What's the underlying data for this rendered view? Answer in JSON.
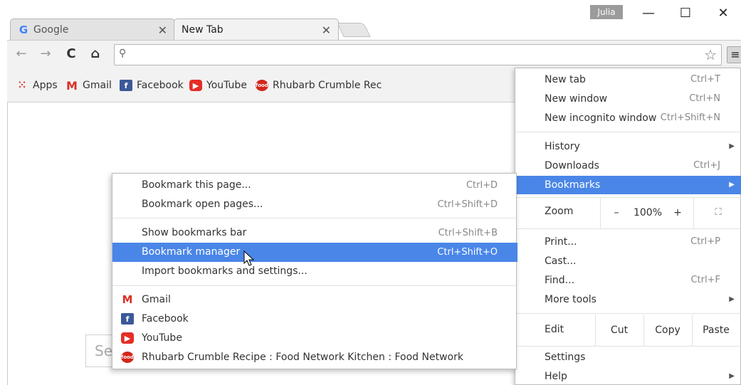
{
  "tabs": [
    {
      "label": "Google",
      "icon": "google-g-icon",
      "active": false
    },
    {
      "label": "New Tab",
      "icon": "",
      "active": true
    }
  ],
  "profile": "Julia",
  "window_controls": {
    "minimize": "—",
    "maximize": "☐",
    "close": "✕"
  },
  "bookmarks_bar": [
    {
      "label": "Apps",
      "icon": "apps-grid-icon"
    },
    {
      "label": "Gmail",
      "icon": "gmail-icon"
    },
    {
      "label": "Facebook",
      "icon": "facebook-icon"
    },
    {
      "label": "YouTube",
      "icon": "youtube-icon"
    },
    {
      "label": "Rhubarb Crumble Rec",
      "icon": "food-network-icon"
    }
  ],
  "search_placeholder": "Se",
  "main_menu": {
    "new_tab": {
      "label": "New tab",
      "shortcut": "Ctrl+T"
    },
    "new_window": {
      "label": "New window",
      "shortcut": "Ctrl+N"
    },
    "new_incognito": {
      "label": "New incognito window",
      "shortcut": "Ctrl+Shift+N"
    },
    "history": {
      "label": "History"
    },
    "downloads": {
      "label": "Downloads",
      "shortcut": "Ctrl+J"
    },
    "bookmarks": {
      "label": "Bookmarks"
    },
    "zoom": {
      "label": "Zoom",
      "minus": "–",
      "value": "100%",
      "plus": "+"
    },
    "print": {
      "label": "Print...",
      "shortcut": "Ctrl+P"
    },
    "cast": {
      "label": "Cast..."
    },
    "find": {
      "label": "Find...",
      "shortcut": "Ctrl+F"
    },
    "more_tools": {
      "label": "More tools"
    },
    "edit": {
      "label": "Edit",
      "cut": "Cut",
      "copy": "Copy",
      "paste": "Paste"
    },
    "settings": {
      "label": "Settings"
    },
    "help": {
      "label": "Help"
    }
  },
  "bookmarks_submenu": {
    "bookmark_page": {
      "label": "Bookmark this page...",
      "shortcut": "Ctrl+D"
    },
    "bookmark_open_pages": {
      "label": "Bookmark open pages...",
      "shortcut": "Ctrl+Shift+D"
    },
    "show_bar": {
      "label": "Show bookmarks bar",
      "shortcut": "Ctrl+Shift+B"
    },
    "manager": {
      "label": "Bookmark manager",
      "shortcut": "Ctrl+Shift+O"
    },
    "import": {
      "label": "Import bookmarks and settings..."
    },
    "items": [
      {
        "label": "Gmail",
        "icon": "gmail-icon"
      },
      {
        "label": "Facebook",
        "icon": "facebook-icon"
      },
      {
        "label": "YouTube",
        "icon": "youtube-icon"
      },
      {
        "label": "Rhubarb Crumble Recipe : Food Network Kitchen : Food Network",
        "icon": "food-network-icon"
      }
    ]
  },
  "colors": {
    "highlight": "#4a86e8",
    "menu_border": "#bcbcbc"
  }
}
